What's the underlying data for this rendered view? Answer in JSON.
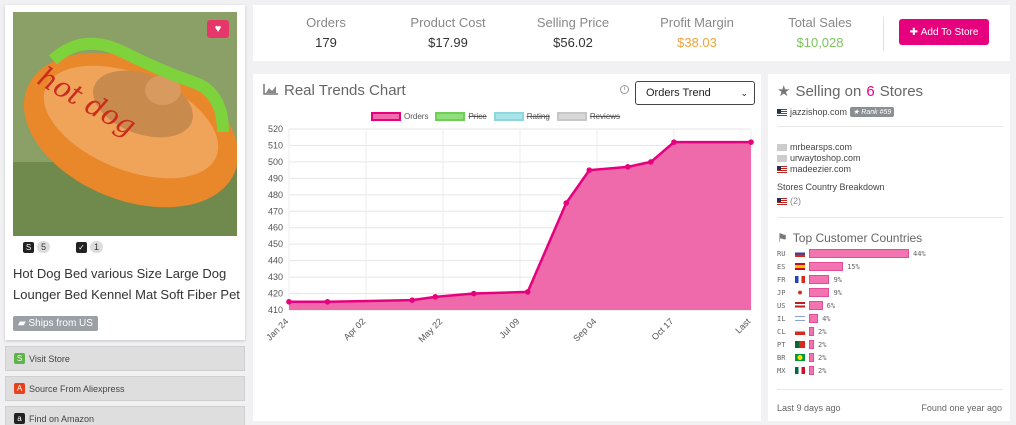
{
  "product": {
    "title": "Hot Dog Bed various Size Large Dog Lounger Bed Kennel Mat Soft Fiber Pet",
    "shopify_count": "5",
    "other_count": "1",
    "ships_from": "Ships from US",
    "image_text": "hot dog",
    "heart_icon": "heart-icon"
  },
  "actions": {
    "visit_store": "Visit Store",
    "source_aliexpress": "Source From Aliexpress",
    "find_amazon": "Find on Amazon"
  },
  "stats": {
    "orders_label": "Orders",
    "orders_value": "179",
    "cost_label": "Product Cost",
    "cost_value": "$17.99",
    "price_label": "Selling Price",
    "price_value": "$56.02",
    "margin_label": "Profit Margin",
    "margin_value": "$38.03",
    "sales_label": "Total Sales",
    "sales_value": "$10,028",
    "add_button": "Add To Store",
    "colors": {
      "margin": "#f0a33a",
      "sales": "#7cc45a",
      "accent": "#e7007d"
    }
  },
  "chart_panel": {
    "title": "Real Trends Chart",
    "select_value": "Orders Trend",
    "legend": [
      "Orders",
      "Price",
      "Rating",
      "Reviews"
    ]
  },
  "chart_data": {
    "type": "area",
    "y_ticks": [
      "520",
      "510",
      "500",
      "490",
      "480",
      "470",
      "460",
      "450",
      "440",
      "430",
      "420",
      "410"
    ],
    "x_ticks": [
      "Jan 24",
      "Apr 02",
      "May 22",
      "Jul 09",
      "Sep 04",
      "Oct 17",
      "Last"
    ],
    "ylim": [
      410,
      520
    ],
    "series": [
      {
        "name": "Orders",
        "color": "#e7007d",
        "fill": "#ee6aaa",
        "points": [
          [
            0,
            415
          ],
          [
            0.5,
            415
          ],
          [
            1.6,
            416
          ],
          [
            1.9,
            418
          ],
          [
            2.4,
            420
          ],
          [
            3.1,
            421
          ],
          [
            3.6,
            475
          ],
          [
            3.9,
            495
          ],
          [
            4.4,
            497
          ],
          [
            4.7,
            500
          ],
          [
            5.0,
            512
          ],
          [
            6.0,
            512
          ]
        ]
      }
    ]
  },
  "stores": {
    "title_prefix": "Selling on",
    "count": "6",
    "title_suffix": "Stores",
    "main_store": "jazzishop.com",
    "rank": "Rank #59",
    "other_stores": [
      "mrbearsps.com",
      "urwaytoshop.com",
      "madeezier.com"
    ],
    "country_breakdown_label": "Stores Country Breakdown",
    "country_breakdown_value": "(2)",
    "top_countries_title": "Top Customer Countries",
    "countries": [
      {
        "code": "RU",
        "pct": "44%",
        "value": 44
      },
      {
        "code": "ES",
        "pct": "15%",
        "value": 15
      },
      {
        "code": "FR",
        "pct": "9%",
        "value": 9
      },
      {
        "code": "JP",
        "pct": "9%",
        "value": 9
      },
      {
        "code": "US",
        "pct": "6%",
        "value": 6
      },
      {
        "code": "IL",
        "pct": "4%",
        "value": 4
      },
      {
        "code": "CL",
        "pct": "2%",
        "value": 2
      },
      {
        "code": "PT",
        "pct": "2%",
        "value": 2
      },
      {
        "code": "BR",
        "pct": "2%",
        "value": 2
      },
      {
        "code": "MX",
        "pct": "2%",
        "value": 2
      }
    ],
    "last_label": "Last",
    "last_value": "9 days ago",
    "found_label": "Found",
    "found_value": "one year ago"
  }
}
